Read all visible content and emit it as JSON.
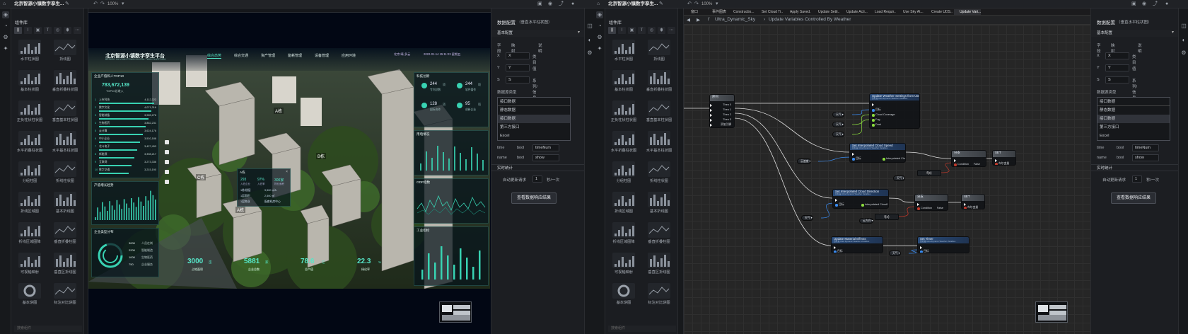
{
  "app": {
    "left_title": "北京智源小镇数字孪生...",
    "right_title": "北京智源小镇数字孪生...",
    "zoom": "100%"
  },
  "components": {
    "title": "组件库",
    "search_placeholder": "搜索组件",
    "items": [
      "水平柱状图",
      "折线图",
      "基本柱状图",
      "垂直折叠柱状图",
      "正负柱状柱状图",
      "垂直基本柱状图",
      "水平折叠柱状图",
      "水平基本柱状图",
      "分组柱图",
      "折线柱状图",
      "折线区域图",
      "基本折线图",
      "折线区域图降",
      "垂直折叠柱图",
      "可视轴映射",
      "垂直区折线图",
      "基本饼图",
      "标注对比饼图"
    ]
  },
  "dashboard": {
    "title": "北京智源小镇数字孪生平台",
    "subtitle": "BEIJING ZHIYUAN TOWN DIGITAL TWIN PLATFORM",
    "nav": [
      "综合态势",
      "综合交通",
      "资产管理",
      "能耗管理",
      "设备管理",
      "应用环境"
    ],
    "location": "北京 晴 多云",
    "datetime": "2022-01-14 15:11:23 星期五",
    "panel_enterprise": {
      "title": "企业产值和人TOP10",
      "value": "783,672,139",
      "value_label": "TOP10总收入",
      "rows": [
        {
          "name": "上市科技",
          "value": "4,112,322"
        },
        {
          "name": "数字文化",
          "value": "4,071,316"
        },
        {
          "name": "智能装备",
          "value": "3,965,276"
        },
        {
          "name": "生物医药",
          "value": "3,862,231"
        },
        {
          "name": "云计算",
          "value": "3,624,176"
        },
        {
          "name": "中小企业",
          "value": "3,502,188"
        },
        {
          "name": "北斗电子",
          "value": "3,427,453"
        },
        {
          "name": "新能源",
          "value": "3,398,217"
        },
        {
          "name": "互联网",
          "value": "3,273,336"
        },
        {
          "name": "数字交通",
          "value": "3,215,190"
        }
      ]
    },
    "panel_growth": {
      "title": "产值增长趋势"
    },
    "panel_dist": {
      "title": "企业类型分布",
      "items": [
        {
          "count": "3000",
          "name": "人员在岗"
        },
        {
          "count": "2200",
          "name": "智能制造"
        },
        {
          "count": "1000",
          "name": "生物医药"
        },
        {
          "count": "750",
          "name": "企业服务"
        }
      ]
    },
    "building_labels": [
      "A栋",
      "B栋",
      "C栋",
      "A栋"
    ],
    "popup": {
      "title": "A栋",
      "stats": [
        {
          "value": "293",
          "label": "入驻企业"
        },
        {
          "value": "97%",
          "label": "入驻率"
        },
        {
          "value": "300家",
          "label": "物业面积"
        }
      ],
      "rows": [
        {
          "k": "1栋/楼层",
          "v": "9,500 ㎡/k"
        },
        {
          "k": "1层面积",
          "v": "2,500 ㎡"
        },
        {
          "k": "1层物业",
          "v": "配套机房中心"
        }
      ]
    },
    "stats_bottom": [
      {
        "value": "3000",
        "unit": "亩",
        "label": "占地面积"
      },
      {
        "value": "5881",
        "unit": "家",
        "label": "企业总数"
      },
      {
        "value": "78.6",
        "unit": "亿",
        "label": "总产值"
      },
      {
        "value": "22.3",
        "unit": "%",
        "label": "绿化率"
      }
    ],
    "panel_tech": {
      "title": "科技创新",
      "items": [
        {
          "value": "244",
          "unit": "项",
          "label": "专利总数"
        },
        {
          "value": "244",
          "unit": "项",
          "label": "软件著作"
        },
        {
          "value": "128",
          "unit": "项",
          "label": "国际合作"
        },
        {
          "value": "95",
          "unit": "项",
          "label": "创新企业"
        }
      ]
    },
    "panel_energy": {
      "title": "用电情况"
    },
    "panel_gdp": {
      "title": "GDP指数"
    },
    "panel_industry": {
      "title": "工业指标"
    }
  },
  "props": {
    "title": "数据配置",
    "subtitle": "（垂直水平柱状图）",
    "basic_section": "基本配置",
    "field_headers": [
      "字段",
      "映射",
      "说明"
    ],
    "fields": [
      {
        "name": "X",
        "map": "X",
        "desc": "类目"
      },
      {
        "name": "Y",
        "map": "Y",
        "desc": "值"
      },
      {
        "name": "S",
        "map": "S",
        "desc": "系列/信息"
      }
    ],
    "datasource_label": "数据源类型",
    "datasource_value": "接口数据",
    "datasource_options": [
      "静态数据",
      "接口数据",
      "第三方接口",
      "Excel"
    ],
    "extra_fields": [
      {
        "name": "time",
        "type": "bool",
        "value": "timeNum"
      },
      {
        "name": "name",
        "type": "bool",
        "value": "show"
      }
    ],
    "realtime_label": "实时统计",
    "auto_update_label": "自动更新请求",
    "auto_update_value": "1",
    "auto_update_unit": "秒/一次",
    "view_button": "查看数据响应结果"
  },
  "blueprint": {
    "tabs": [
      "窗口",
      "事件图表",
      "Constructio...",
      "Set Cloud Ti...",
      "Apply Saved...",
      "Update Setti...",
      "Update Acti...",
      "Load Requir...",
      "Use Sky At...",
      "Create UDS...",
      "Update Vari..."
    ],
    "breadcrumb_root": "Ultra_Dynamic_Sky",
    "breadcrumb_page": "Update Variables Controlled By Weather",
    "seq_node": {
      "title": "序列",
      "pins": [
        "Then 0",
        "Then 1",
        "Then 2",
        "Then 3",
        "添加引脚"
      ]
    },
    "n_weather": {
      "title": "Update Weather Settings from UDS",
      "sub": "目标是 Ultra Dynamic Weather Variables",
      "pins": [
        "目标",
        "Cloud Coverage",
        "Fog",
        "Dust"
      ]
    },
    "n_cloud_speed": {
      "title": "Set Interpolated Cloud Speed",
      "sub": "目标是 Ultra Dynamic Weather Variables",
      "pins": [
        "目标",
        "Interpolated Cloud Speed"
      ]
    },
    "n_cloud_dir": {
      "title": "Set Interpolated Cloud Direction",
      "sub": "目标是 Ultra Dynamic Weather Variables",
      "pins": [
        "目标",
        "Interpolated Cloud Direction"
      ]
    },
    "n_material": {
      "title": "Update Material Effects",
      "sub": "目标是 Ultra Dynamic Weather Variables",
      "pins": [
        "目标"
      ]
    },
    "n_set_timer": {
      "title": "Set Timer",
      "sub": "目标是 Ultra Dynamic Weather Variables",
      "pins": [
        "目标"
      ]
    },
    "n_branch1": {
      "title": "分支",
      "pins": [
        "Condition",
        "False"
      ]
    },
    "n_branch2": {
      "title": "分支",
      "pins": [
        "Condition",
        "False"
      ]
    },
    "n_set1": {
      "title": "SET",
      "pins": [
        "布尔变量"
      ]
    },
    "n_set2": {
      "title": "SET",
      "pins": [
        "布尔变量"
      ]
    },
    "var_labels": [
      "天气 ▾",
      "天气 ▾",
      "天气 ▾",
      "云速度 ▾",
      "天气 ▾",
      "云方向 ▾",
      "天气 ▾",
      "天气 ▾"
    ],
    "fx_label": "f(x)"
  },
  "colors": {
    "accent": "#38d2b2",
    "exec": "#ffffff",
    "object_pin": "#3a8cf2",
    "float_pin": "#8bdc3e",
    "bool_pin": "#c0392b"
  }
}
